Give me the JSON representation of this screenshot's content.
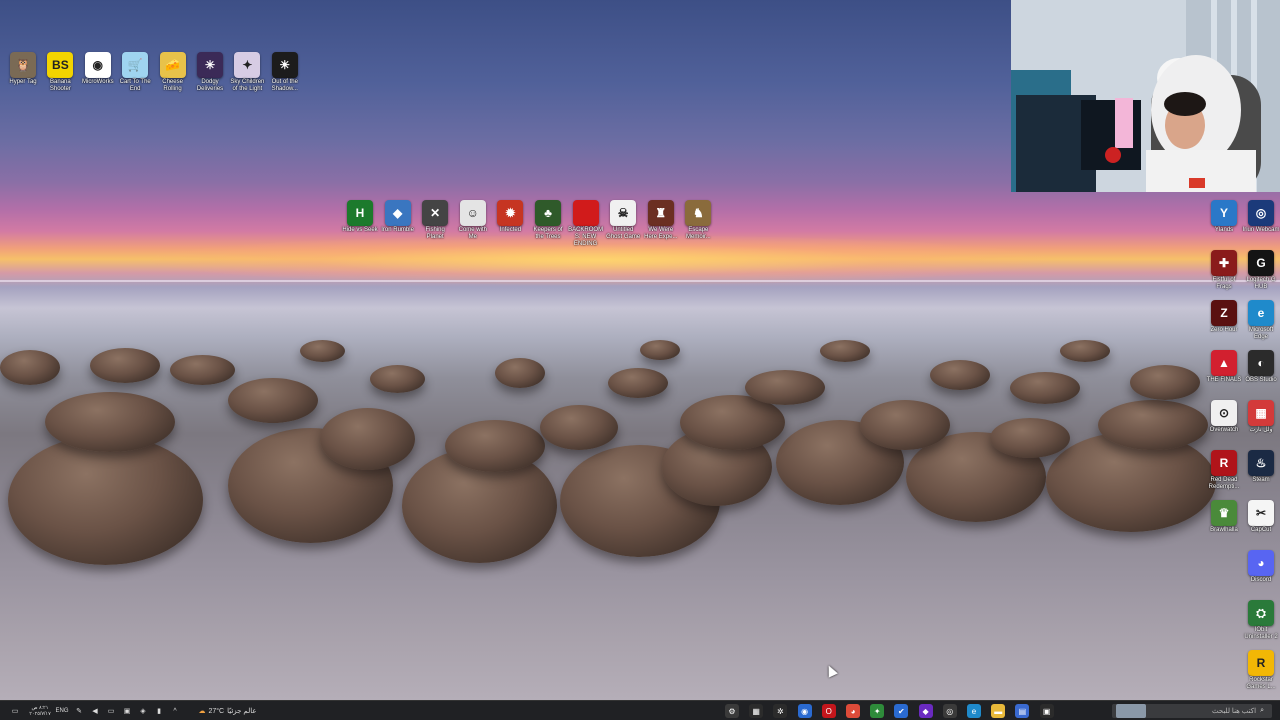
{
  "desktop": {
    "top_row": [
      {
        "label": "Hyper Tag",
        "icon": "owl-icon",
        "color": "#7a6a55",
        "glyph": "🦉"
      },
      {
        "label": "Banana Shooter",
        "icon": "banana-shooter-icon",
        "color": "#f2d400",
        "glyph": "BS"
      },
      {
        "label": "MicroWorks",
        "icon": "microworks-icon",
        "color": "#ffffff",
        "glyph": "◉"
      },
      {
        "label": "Cart To The End",
        "icon": "cart-icon",
        "color": "#9fd4f0",
        "glyph": "🛒"
      },
      {
        "label": "Cheese Rolling",
        "icon": "cheese-icon",
        "color": "#e8c24a",
        "glyph": "🧀"
      },
      {
        "label": "Dodgy Deliveries",
        "icon": "dodgy-icon",
        "color": "#3b2a57",
        "glyph": "✳"
      },
      {
        "label": "Sky Children of the Light",
        "icon": "sky-icon",
        "color": "#d7cce4",
        "glyph": "✦"
      },
      {
        "label": "Out of the Shadow...",
        "icon": "sun-icon",
        "color": "#1c1c1c",
        "glyph": "☀"
      }
    ],
    "middle_row": [
      {
        "label": "Hide vs Seek",
        "icon": "hide-seek-icon",
        "color": "#1c7a2c",
        "glyph": "H"
      },
      {
        "label": "Iron Rumble",
        "icon": "diamond-icon",
        "color": "#3a76c0",
        "glyph": "◆"
      },
      {
        "label": "Fishing Planet",
        "icon": "fishing-icon",
        "color": "#444444",
        "glyph": "✕"
      },
      {
        "label": "Come with Me",
        "icon": "come-with-me-icon",
        "color": "#e4e4e4",
        "glyph": "☺"
      },
      {
        "label": "Infected",
        "icon": "infected-icon",
        "color": "#c63522",
        "glyph": "✹"
      },
      {
        "label": "Keepers of the Trees",
        "icon": "keepers-icon",
        "color": "#2f5a2a",
        "glyph": "♣"
      },
      {
        "label": "BACKROOMS: NEW ENDING",
        "icon": "backrooms-icon",
        "color": "#d11b1b",
        "glyph": " "
      },
      {
        "label": "Untitled Ghost Game",
        "icon": "ghost-game-icon",
        "color": "#f0f0f0",
        "glyph": "☠"
      },
      {
        "label": "We Were Here Expe...",
        "icon": "we-were-here-icon",
        "color": "#6b2f22",
        "glyph": "♜"
      },
      {
        "label": "Escape Memoir...",
        "icon": "escape-memoir-icon",
        "color": "#8a6b3c",
        "glyph": "♞"
      }
    ],
    "right_column_left": [
      {
        "label": "Ylands",
        "icon": "ylands-icon",
        "color": "#2a78c8",
        "glyph": "Y"
      },
      {
        "label": "Fistful of Frags",
        "icon": "frags-icon",
        "color": "#8a1b1b",
        "glyph": "✚"
      },
      {
        "label": "Zero Hour",
        "icon": "zero-hour-icon",
        "color": "#5a1010",
        "glyph": "Z"
      },
      {
        "label": "THE FINALS",
        "icon": "the-finals-icon",
        "color": "#d2202f",
        "glyph": "▲"
      },
      {
        "label": "Overwatch",
        "icon": "overwatch-icon",
        "color": "#f0f0f0",
        "glyph": "⊙"
      },
      {
        "label": "Red Dead Redempti...",
        "icon": "red-dead-icon",
        "color": "#b0141a",
        "glyph": "R"
      },
      {
        "label": "Brawlhalla",
        "icon": "brawlhalla-icon",
        "color": "#4a8a3a",
        "glyph": "♛"
      }
    ],
    "right_column_right": [
      {
        "label": "Iriun Webcam",
        "icon": "iriun-icon",
        "color": "#1b3a7a",
        "glyph": "◎"
      },
      {
        "label": "Logitech G HUB",
        "icon": "logitech-icon",
        "color": "#141414",
        "glyph": "G"
      },
      {
        "label": "Microsoft Edge",
        "icon": "edge-icon",
        "color": "#1f8acb",
        "glyph": "e"
      },
      {
        "label": "OBS Studio",
        "icon": "obs-icon",
        "color": "#2b2b2b",
        "glyph": "◐"
      },
      {
        "label": "ولل نارت",
        "icon": "grid-app-icon",
        "color": "#d33a3a",
        "glyph": "▦"
      },
      {
        "label": "Steam",
        "icon": "steam-icon",
        "color": "#1b2a44",
        "glyph": "♨"
      },
      {
        "label": "CapCut",
        "icon": "capcut-icon",
        "color": "#f5f5f5",
        "glyph": "✂"
      },
      {
        "label": "Discord",
        "icon": "discord-icon",
        "color": "#5865f2",
        "glyph": "◕"
      },
      {
        "label": "IObit Uninstaller 2",
        "icon": "uninstaller-icon",
        "color": "#2a7a3a",
        "glyph": "⛭"
      },
      {
        "label": "Rockstar Games L...",
        "icon": "rockstar-icon",
        "color": "#f2b705",
        "glyph": "R"
      }
    ]
  },
  "taskbar": {
    "clock_time": "٨:٢١ ص",
    "clock_date": "٢٠٢٥/٧/١٧",
    "language": "ENG",
    "weather": "27°C",
    "weather_label": "عالم جزئيًا",
    "search_placeholder": "اكتب هنا للبحث",
    "apps": [
      {
        "icon": "settings-icon",
        "glyph": "⚙",
        "color": "#3a3a3a"
      },
      {
        "icon": "grid-icon",
        "glyph": "▦",
        "color": "#2b2b2b"
      },
      {
        "icon": "gear-icon",
        "glyph": "✲",
        "color": "#2b2b2b"
      },
      {
        "icon": "blue-app-icon",
        "glyph": "◉",
        "color": "#2a6ad0"
      },
      {
        "icon": "opera-icon",
        "glyph": "O",
        "color": "#c4161c"
      },
      {
        "icon": "chrome-icon",
        "glyph": "◕",
        "color": "#dd4b39"
      },
      {
        "icon": "green-app-icon",
        "glyph": "✦",
        "color": "#2e8b3a"
      },
      {
        "icon": "check-icon",
        "glyph": "✔",
        "color": "#2a6ad0"
      },
      {
        "icon": "purple-app-icon",
        "glyph": "◆",
        "color": "#6a2ac0"
      },
      {
        "icon": "chat-icon",
        "glyph": "◎",
        "color": "#3a3a3a"
      },
      {
        "icon": "edge-icon",
        "glyph": "e",
        "color": "#1f8acb"
      },
      {
        "icon": "folder-icon",
        "glyph": "▬",
        "color": "#e8b93a"
      },
      {
        "icon": "store-icon",
        "glyph": "▤",
        "color": "#3a6ad0"
      },
      {
        "icon": "task-view-icon",
        "glyph": "▣",
        "color": "#2b2b2b"
      }
    ]
  }
}
